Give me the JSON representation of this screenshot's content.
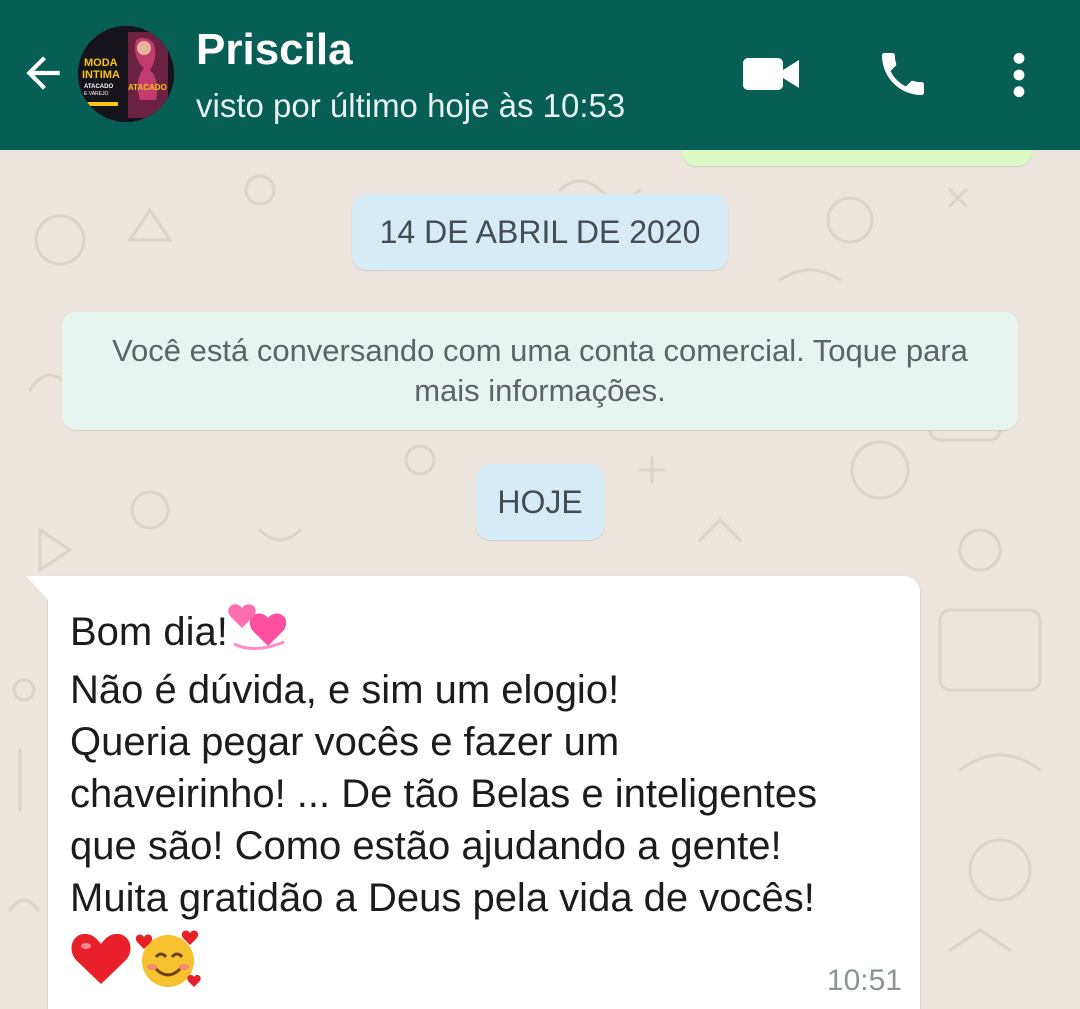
{
  "header": {
    "contact_name": "Priscila",
    "last_seen": "visto por último hoje às 10:53",
    "avatar_text": {
      "line1": "MODA",
      "line2": "INTIMA",
      "line3": "ATACADO",
      "line4": "E VAREJO",
      "line5": "ATACADO"
    },
    "icons": [
      "back-arrow-icon",
      "video-call-icon",
      "phone-icon",
      "more-vert-icon"
    ],
    "background_color": "#075e54"
  },
  "chat": {
    "date_chip": "14 DE ABRIL DE 2020",
    "business_notice": "Você está conversando com uma conta comercial. Toque para mais informações.",
    "today_chip": "HOJE",
    "message": {
      "lines": [
        "Bom dia!",
        "Não é dúvida, e sim um elogio!",
        "Queria pegar vocês e fazer um",
        "chaveirinho! ... De tão Belas e inteligentes",
        "que são! Como estão ajudando a gente!",
        "Muita gratidão a Deus pela vida de vocês!"
      ],
      "emojis": [
        "revolving-hearts-emoji",
        "red-heart-emoji",
        "smiling-face-with-hearts-emoji"
      ],
      "time": "10:51"
    },
    "colors": {
      "wallpaper": "#ece5dd",
      "date_chip": "#d5ebf5",
      "notice": "#e7f4ef",
      "incoming_bubble": "#ffffff",
      "outgoing_bubble": "#dcf8c6"
    }
  }
}
